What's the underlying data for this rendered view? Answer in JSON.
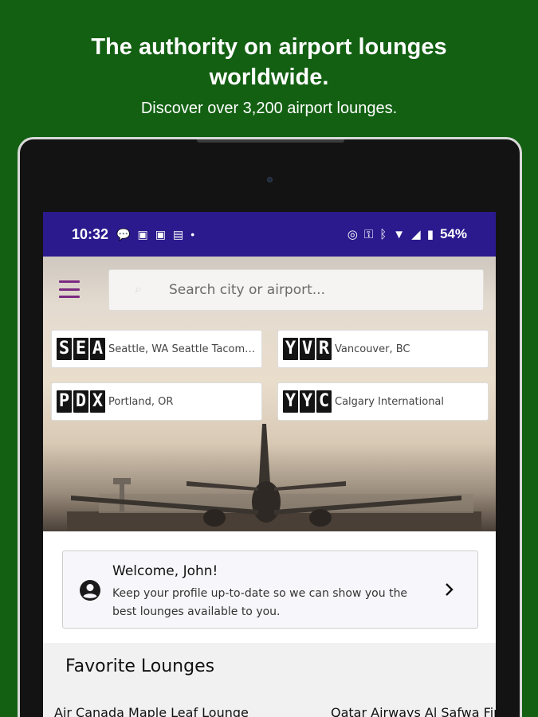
{
  "promo": {
    "title": "The authority on airport lounges worldwide.",
    "subtitle": "Discover over 3,200 airport lounges."
  },
  "status_bar": {
    "time": "10:32",
    "battery": "54%"
  },
  "search": {
    "placeholder": "Search city or airport..."
  },
  "airports": [
    {
      "code": [
        "S",
        "E",
        "A"
      ],
      "name": "Seattle, WA Seattle Tacoma International"
    },
    {
      "code": [
        "Y",
        "V",
        "R"
      ],
      "name": "Vancouver, BC"
    },
    {
      "code": [
        "P",
        "D",
        "X"
      ],
      "name": "Portland, OR"
    },
    {
      "code": [
        "Y",
        "Y",
        "C"
      ],
      "name": "Calgary International"
    }
  ],
  "welcome": {
    "title": "Welcome, John!",
    "text": "Keep your profile up-to-date so we can show you the best lounges available to you."
  },
  "favorites": {
    "title": "Favorite Lounges",
    "items": [
      "Air Canada Maple Leaf Lounge",
      "Qatar Airways Al Safwa First Lounge"
    ]
  },
  "colors": {
    "background": "#136013",
    "status_bar": "#2a1a8e",
    "menu_accent": "#7a2a80"
  }
}
